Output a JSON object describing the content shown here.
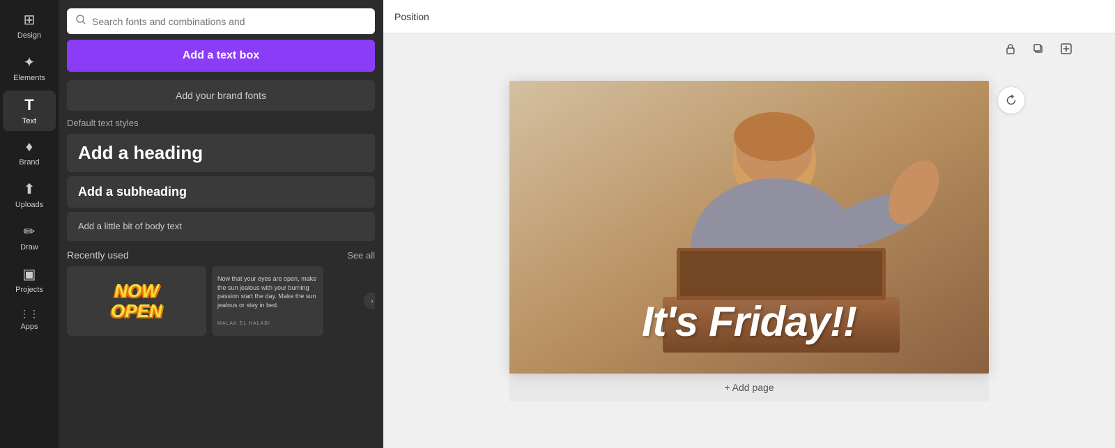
{
  "sidebar": {
    "items": [
      {
        "id": "design",
        "label": "Design",
        "icon": "⊞"
      },
      {
        "id": "elements",
        "label": "Elements",
        "icon": "✦"
      },
      {
        "id": "text",
        "label": "Text",
        "icon": "T",
        "active": true
      },
      {
        "id": "brand",
        "label": "Brand",
        "icon": "♦"
      },
      {
        "id": "uploads",
        "label": "Uploads",
        "icon": "↑"
      },
      {
        "id": "draw",
        "label": "Draw",
        "icon": "✏"
      },
      {
        "id": "projects",
        "label": "Projects",
        "icon": "▣"
      },
      {
        "id": "apps",
        "label": "Apps",
        "icon": "⋮⋮"
      }
    ]
  },
  "text_panel": {
    "search_placeholder": "Search fonts and combinations and",
    "add_text_box_label": "Add a text box",
    "brand_fonts_label": "Add your brand fonts",
    "default_styles_label": "Default text styles",
    "heading_label": "Add a heading",
    "subheading_label": "Add a subheading",
    "body_label": "Add a little bit of body text",
    "recently_used_label": "Recently used",
    "see_all_label": "See all",
    "now_open_text": "NOW\nOPEN",
    "recently_text_content": "Now that your eyes are open, make the sun jealous with your burning passion start the day. Make the sun jealous or stay in bed.",
    "recently_text_author": "MALAK EL HALABI"
  },
  "canvas": {
    "top_bar_title": "Position",
    "canvas_text": "It's Friday!!",
    "add_page_label": "+ Add page"
  },
  "toolbar": {
    "lock_icon": "lock-icon",
    "duplicate_icon": "duplicate-icon",
    "add_icon": "add-icon",
    "refresh_icon": "refresh-icon"
  }
}
